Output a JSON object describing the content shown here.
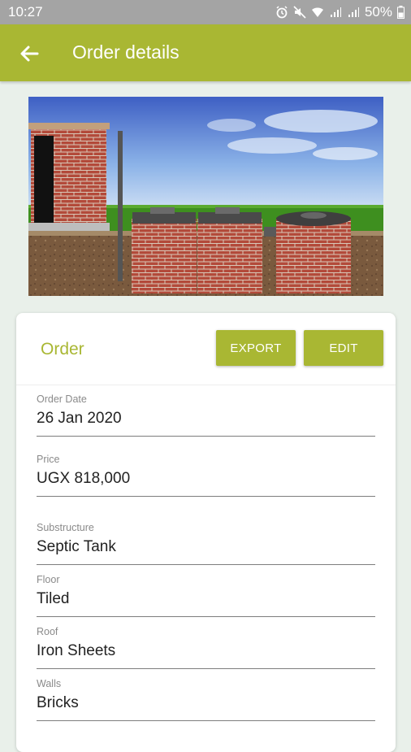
{
  "status_bar": {
    "time": "10:27",
    "battery": "50%"
  },
  "appbar": {
    "title": "Order details"
  },
  "card": {
    "title": "Order",
    "export_label": "EXPORT",
    "edit_label": "EDIT",
    "fields": [
      {
        "label": "Order Date",
        "value": "26 Jan 2020"
      },
      {
        "label": "Price",
        "value": "UGX 818,000"
      },
      {
        "label": "Substructure",
        "value": "Septic Tank"
      },
      {
        "label": "Floor",
        "value": "Tiled"
      },
      {
        "label": "Roof",
        "value": "Iron Sheets"
      },
      {
        "label": "Walls",
        "value": "Bricks"
      }
    ]
  },
  "colors": {
    "accent": "#a9b733",
    "status_bar": "#a4a4a4",
    "background": "#e9f0ea"
  }
}
